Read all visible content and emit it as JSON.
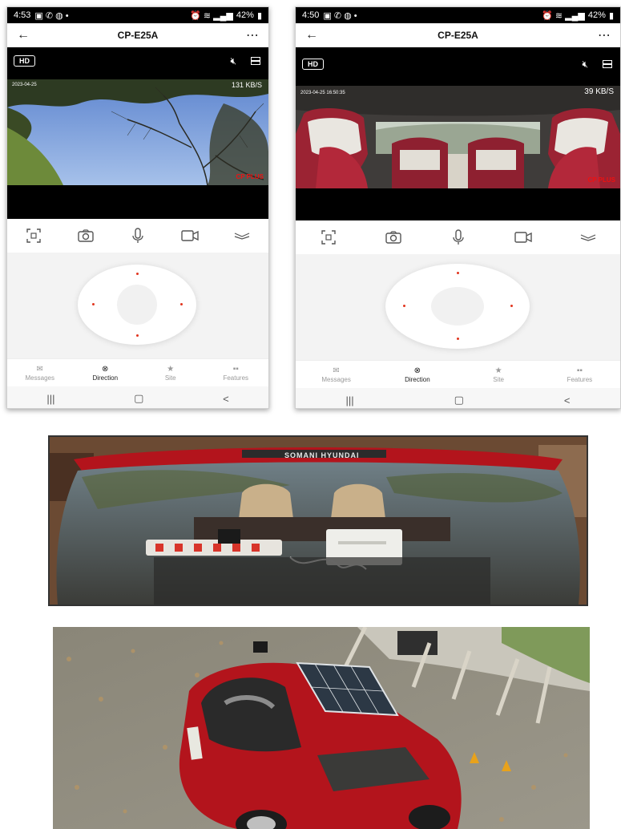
{
  "phone1": {
    "status": {
      "time": "4:53",
      "battery": "42%"
    },
    "title": "CP-E25A",
    "hd_label": "HD",
    "data_rate": "131 KB/S",
    "timestamp": "2023-04-25",
    "brand": "CP PLUS",
    "nav": [
      "Messages",
      "Direction",
      "Site",
      "Features"
    ],
    "active_nav": "Direction"
  },
  "phone2": {
    "status": {
      "time": "4:50",
      "battery": "42%"
    },
    "title": "CP-E25A",
    "hd_label": "HD",
    "data_rate": "39 KB/S",
    "timestamp": "2023-04-25 16:50:35",
    "brand": "CP PLUS",
    "nav": [
      "Messages",
      "Direction",
      "Site",
      "Features"
    ],
    "active_nav": "Direction"
  },
  "photo_rear": {
    "badge_text": "SOMANI HYUNDAI"
  },
  "colors": {
    "accent": "#e1341e",
    "car_red": "#b3141c",
    "sky": "#7fa2dc"
  },
  "icons": {
    "back": "back-arrow-icon",
    "more": "more-dots-icon",
    "mute": "speaker-mute-icon",
    "layout": "layout-icon",
    "screenshot": "screenshot-icon",
    "camera": "camera-icon",
    "mic": "microphone-icon",
    "record": "video-record-icon",
    "collapse": "collapse-icon"
  }
}
